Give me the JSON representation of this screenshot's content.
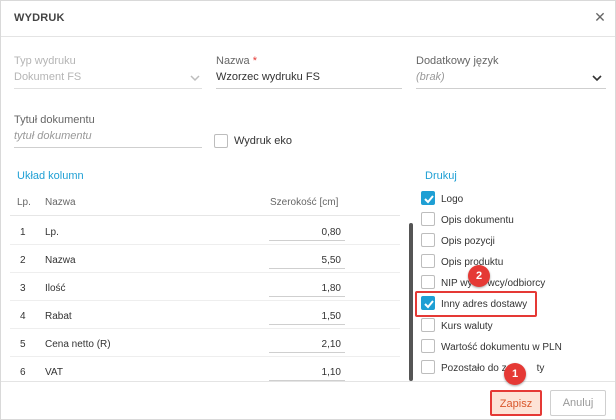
{
  "dialog": {
    "title": "WYDRUK",
    "close_icon": "close-icon"
  },
  "form": {
    "print_type": {
      "label": "Typ wydruku",
      "value": "Dokument FS"
    },
    "name": {
      "label": "Nazwa",
      "required_mark": "*",
      "value": "Wzorzec wydruku FS"
    },
    "extra_language": {
      "label": "Dodatkowy język",
      "value": "(brak)"
    },
    "doc_title": {
      "label": "Tytuł dokumentu",
      "placeholder": "tytuł dokumentu"
    },
    "eco_print": {
      "label": "Wydruk eko",
      "checked": false
    }
  },
  "columns": {
    "section_title": "Układ kolumn",
    "headers": {
      "lp": "Lp.",
      "name": "Nazwa",
      "width": "Szerokość [cm]"
    },
    "rows": [
      {
        "lp": "1",
        "name": "Lp.",
        "width": "0,80"
      },
      {
        "lp": "2",
        "name": "Nazwa",
        "width": "5,50"
      },
      {
        "lp": "3",
        "name": "Ilość",
        "width": "1,80"
      },
      {
        "lp": "4",
        "name": "Rabat",
        "width": "1,50"
      },
      {
        "lp": "5",
        "name": "Cena netto (R)",
        "width": "2,10"
      },
      {
        "lp": "6",
        "name": "VAT",
        "width": "1,10"
      }
    ]
  },
  "print": {
    "section_title": "Drukuj",
    "items": [
      {
        "label": "Logo",
        "checked": true
      },
      {
        "label": "Opis dokumentu",
        "checked": false
      },
      {
        "label": "Opis pozycji",
        "checked": false
      },
      {
        "label": "Opis produktu",
        "checked": false
      },
      {
        "label": "NIP wy",
        "label_tail": "wcy/odbiorcy",
        "checked": false
      },
      {
        "label": "Inny adres dostawy",
        "checked": true
      },
      {
        "label": "Kurs waluty",
        "checked": false
      },
      {
        "label": "Wartość dokumentu w PLN",
        "checked": false
      },
      {
        "label": "Pozostało do z",
        "label_tail": "ty",
        "checked": false
      }
    ]
  },
  "buttons": {
    "save": "Zapisz",
    "cancel": "Anuluj"
  },
  "annotations": {
    "badge_1": "1",
    "badge_2": "2",
    "highlight_color": "#e53935"
  },
  "colors": {
    "accent": "#1e9fd4",
    "annotation": "#e53935"
  }
}
